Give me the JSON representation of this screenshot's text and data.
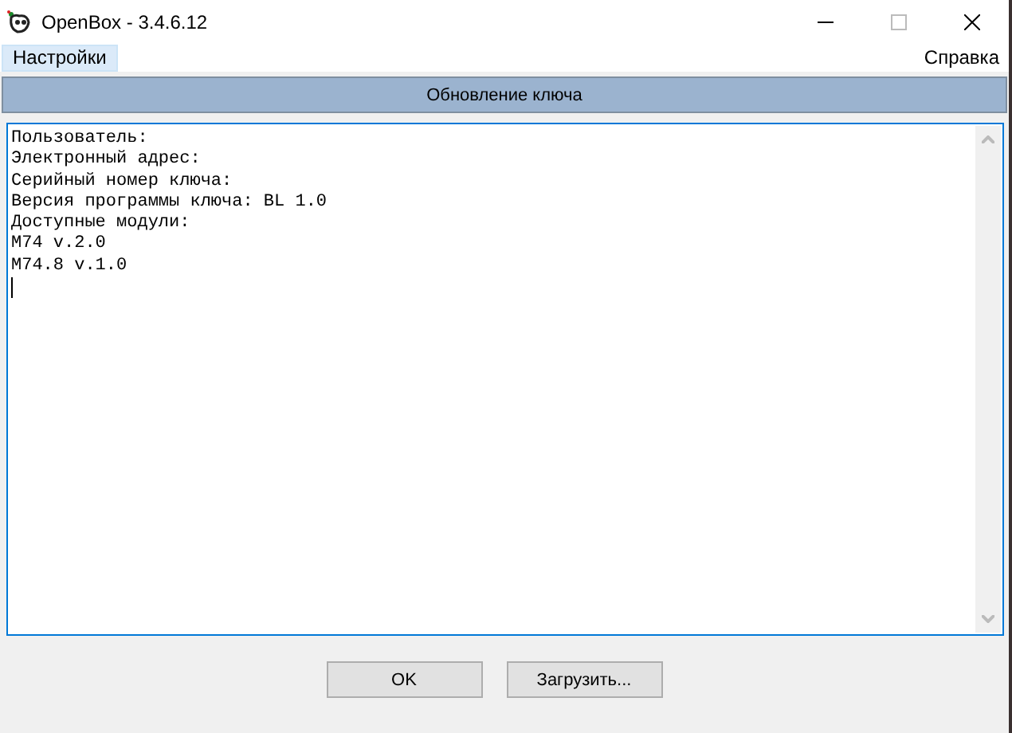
{
  "window": {
    "title": "OpenBox - 3.4.6.12"
  },
  "menu": [
    {
      "label": "Настройки",
      "highlighted": true
    },
    {
      "label": "Справка",
      "highlighted": false
    }
  ],
  "header": {
    "title": "Обновление ключа"
  },
  "text_area": {
    "lines": [
      "Пользователь:",
      "Электронный адрес:",
      "Серийный номер ключа:",
      "Версия программы ключа: BL 1.0",
      "Доступные модули:",
      "M74 v.2.0",
      "M74.8 v.1.0"
    ],
    "focused": true
  },
  "buttons": [
    "OK",
    "Загрузить..."
  ]
}
